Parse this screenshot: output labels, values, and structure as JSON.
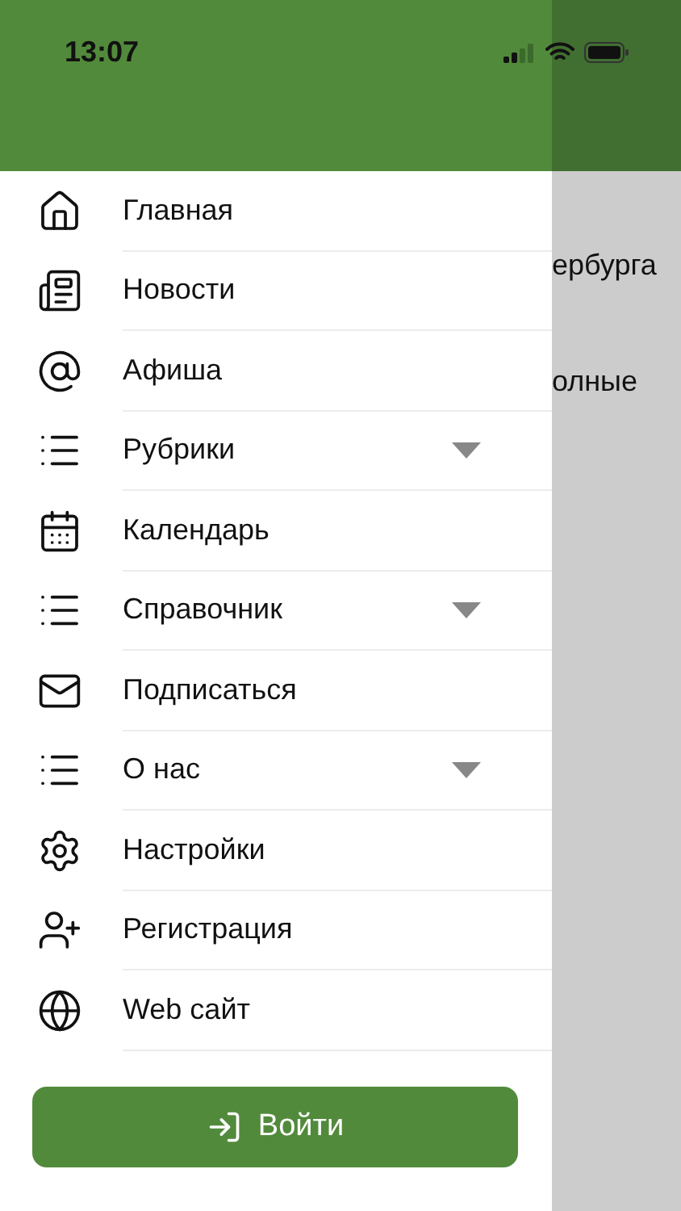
{
  "status_bar": {
    "time": "13:07"
  },
  "background_page": {
    "lines": [
      "ербурга",
      "олные"
    ]
  },
  "menu": {
    "items": [
      {
        "label": "Главная",
        "kind": "link"
      },
      {
        "label": "Новости",
        "kind": "link"
      },
      {
        "label": "Афиша",
        "kind": "link"
      },
      {
        "label": "Рубрики",
        "kind": "group"
      },
      {
        "label": "Календарь",
        "kind": "link"
      },
      {
        "label": "Справочник",
        "kind": "group"
      },
      {
        "label": "Подписаться",
        "kind": "link"
      },
      {
        "label": "О нас",
        "kind": "group"
      },
      {
        "label": "Настройки",
        "kind": "link"
      },
      {
        "label": "Регистрация",
        "kind": "link"
      },
      {
        "label": "Web сайт",
        "kind": "link"
      }
    ]
  },
  "login_button": {
    "label": "Войти"
  }
}
